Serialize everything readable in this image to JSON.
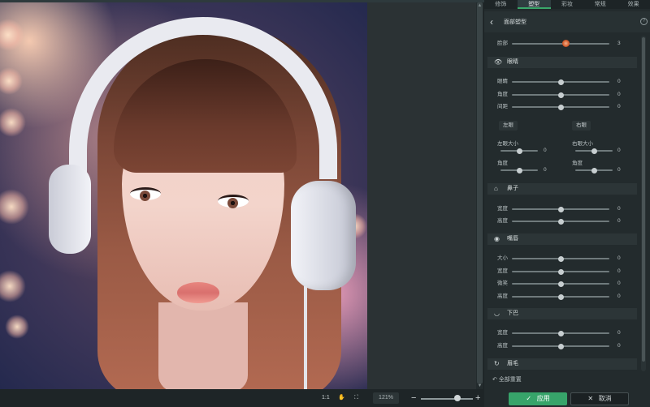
{
  "tabs": [
    "修饰",
    "塑型",
    "彩妆",
    "常规",
    "效果"
  ],
  "active_tab": 1,
  "panel": {
    "title": "面部塑型",
    "back_icon": "back-arrow-icon",
    "help_icon": "help-icon"
  },
  "face_slider": {
    "label": "脸部",
    "value": "3",
    "level": 0.55,
    "knob_color": "#d25a2a"
  },
  "eyes": {
    "title": "眼睛",
    "icon": "eye-icon",
    "sliders": [
      {
        "label": "眼睛",
        "value": "0"
      },
      {
        "label": "角度",
        "value": "0"
      },
      {
        "label": "间距",
        "value": "0"
      }
    ],
    "left_label": "左眼",
    "right_label": "右眼",
    "left_sliders": [
      {
        "label": "左眼大小",
        "value": "0"
      },
      {
        "label": "角度",
        "value": "0"
      }
    ],
    "right_sliders": [
      {
        "label": "右眼大小",
        "value": "0"
      },
      {
        "label": "角度",
        "value": "0"
      }
    ]
  },
  "nose": {
    "title": "鼻子",
    "icon": "nose-icon",
    "sliders": [
      {
        "label": "宽度",
        "value": "0"
      },
      {
        "label": "高度",
        "value": "0"
      }
    ]
  },
  "mouth": {
    "title": "嘴唇",
    "icon": "lips-icon",
    "sliders": [
      {
        "label": "大小",
        "value": "0"
      },
      {
        "label": "宽度",
        "value": "0"
      },
      {
        "label": "微笑",
        "value": "0"
      },
      {
        "label": "高度",
        "value": "0"
      }
    ]
  },
  "chin": {
    "title": "下巴",
    "icon": "chin-icon",
    "sliders": [
      {
        "label": "宽度",
        "value": "0"
      },
      {
        "label": "高度",
        "value": "0"
      }
    ]
  },
  "eyebrow": {
    "title": "眉毛",
    "icon": "eyebrow-icon"
  },
  "reset_label": "全部重置",
  "apply_label": "应用",
  "cancel_label": "取消",
  "bottom": {
    "ratio_label": "1:1",
    "zoom_value": "121%",
    "zoom_level": 0.7
  },
  "colors": {
    "accent": "#37a46a",
    "panel_bg": "#232b2d",
    "app_bg": "#1c2224"
  }
}
